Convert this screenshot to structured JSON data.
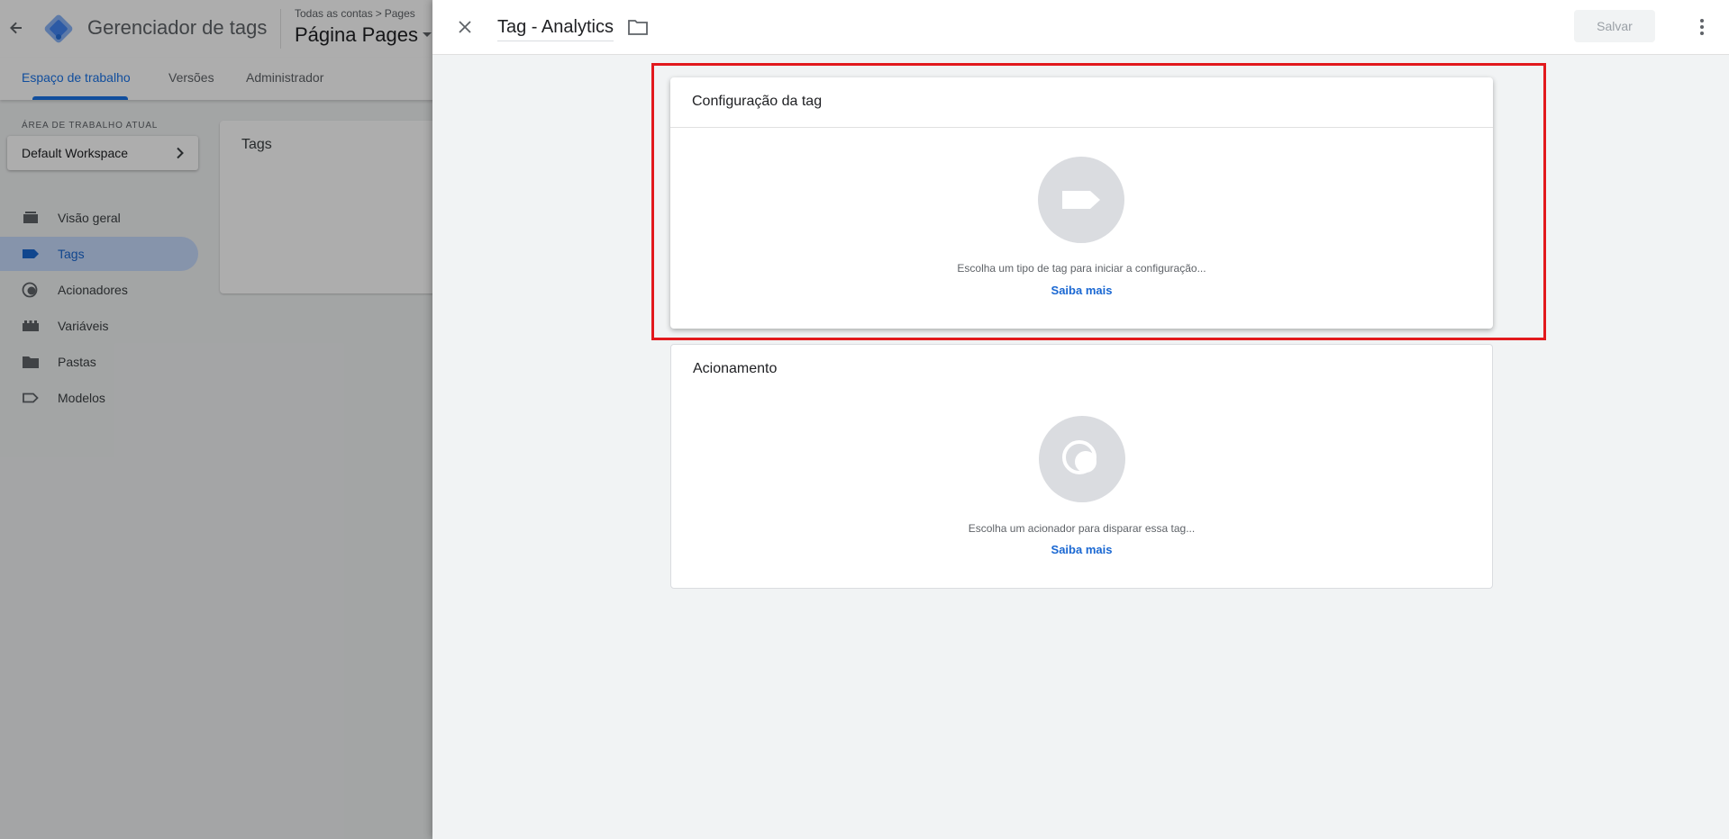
{
  "app": {
    "title": "Gerenciador de tags",
    "breadcrumb_account": "Todas as contas",
    "breadcrumb_separator": ">",
    "breadcrumb_container": "Pages",
    "container_name": "Página Pages"
  },
  "tabs": [
    {
      "label": "Espaço de trabalho",
      "active": true
    },
    {
      "label": "Versões",
      "active": false
    },
    {
      "label": "Administrador",
      "active": false
    }
  ],
  "workspace": {
    "section_label": "ÁREA DE TRABALHO ATUAL",
    "name": "Default Workspace"
  },
  "sidebar": {
    "items": [
      {
        "label": "Visão geral",
        "icon": "overview-icon",
        "active": false
      },
      {
        "label": "Tags",
        "icon": "tag-icon",
        "active": true
      },
      {
        "label": "Acionadores",
        "icon": "trigger-icon",
        "active": false
      },
      {
        "label": "Variáveis",
        "icon": "variables-icon",
        "active": false
      },
      {
        "label": "Pastas",
        "icon": "folder-icon",
        "active": false
      },
      {
        "label": "Modelos",
        "icon": "template-icon",
        "active": false
      }
    ]
  },
  "tags_panel": {
    "title": "Tags"
  },
  "sheet": {
    "tag_name": "Tag - Analytics",
    "save_label": "Salvar",
    "config_card": {
      "title": "Configuração da tag",
      "hint": "Escolha um tipo de tag para iniciar a configuração...",
      "learn_more": "Saiba mais"
    },
    "trigger_card": {
      "title": "Acionamento",
      "hint": "Escolha um acionador para disparar essa tag...",
      "learn_more": "Saiba mais"
    }
  },
  "colors": {
    "accent": "#1a73e8",
    "highlight_border": "#e2191d",
    "nav_active_bg": "#c6dafc"
  }
}
